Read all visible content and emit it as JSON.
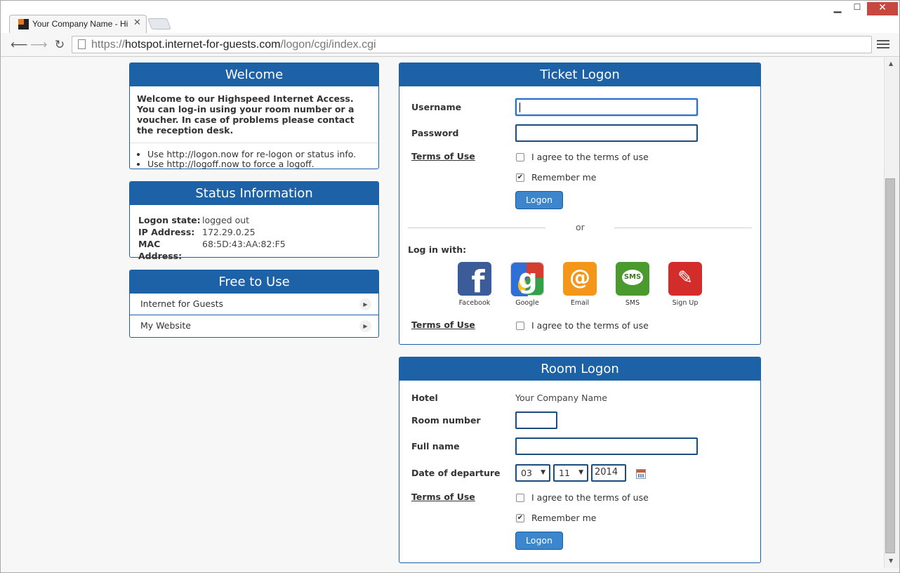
{
  "browser": {
    "tab_title": "Your Company Name - Hi",
    "close_glyph": "✕",
    "url_scheme": "https://",
    "url_host": "hotspot.internet-for-guests.com",
    "url_path": "/logon/cgi/index.cgi",
    "win_min": "▁",
    "win_max": "☐",
    "win_close": "✕"
  },
  "welcome": {
    "title": "Welcome",
    "text": "Welcome to our Highspeed Internet Access. You can log-in using your room number or a voucher. In case of problems please contact the reception desk.",
    "tips": [
      "Use http://logon.now for re-logon or status info.",
      "Use http://logoff.now to force a logoff."
    ]
  },
  "status": {
    "title": "Status Information",
    "rows": [
      {
        "label": "Logon state:",
        "value": "logged out"
      },
      {
        "label": "IP Address:",
        "value": "172.29.0.25"
      },
      {
        "label": "MAC Address:",
        "value": "68:5D:43:AA:82:F5"
      }
    ]
  },
  "free": {
    "title": "Free to Use",
    "items": [
      "Internet for Guests",
      "My Website"
    ]
  },
  "ticket": {
    "title": "Ticket Logon",
    "username_label": "Username",
    "username_value": "",
    "password_label": "Password",
    "password_value": "",
    "terms_label": "Terms of Use",
    "agree_label": "I agree to the terms of use",
    "agree_checked": false,
    "remember_label": "Remember me",
    "remember_checked": true,
    "logon_button": "Logon",
    "or_text": "or",
    "login_with_label": "Log in with:",
    "social": [
      {
        "name": "Facebook",
        "icon": "facebook-icon"
      },
      {
        "name": "Google",
        "icon": "google-icon"
      },
      {
        "name": "Email",
        "icon": "email-icon"
      },
      {
        "name": "SMS",
        "icon": "sms-icon"
      },
      {
        "name": "Sign Up",
        "icon": "signup-icon"
      }
    ],
    "social_terms_label": "Terms of Use",
    "social_agree_label": "I agree to the terms of use"
  },
  "room": {
    "title": "Room Logon",
    "hotel_label": "Hotel",
    "hotel_value": "Your Company Name",
    "room_label": "Room number",
    "room_value": "",
    "name_label": "Full name",
    "name_value": "",
    "departure_label": "Date of departure",
    "departure_day": "03",
    "departure_month": "11",
    "departure_year": "2014",
    "terms_label": "Terms of Use",
    "agree_label": "I agree to the terms of use",
    "remember_label": "Remember me",
    "logon_button": "Logon"
  },
  "colors": {
    "header_blue": "#1d62a6",
    "button_blue": "#3b86cc",
    "close_red": "#c7483e"
  }
}
